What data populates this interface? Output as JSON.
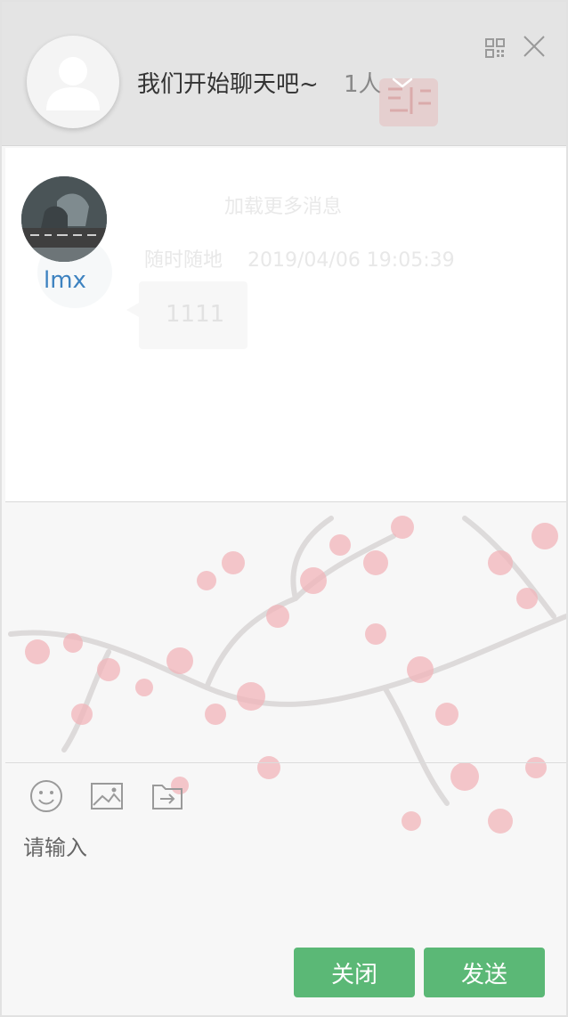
{
  "header": {
    "group_name": "我们开始聊天吧~",
    "member_count": "1人"
  },
  "messages": {
    "load_more": "加载更多消息",
    "items": [
      {
        "sender": "lmx",
        "source": "随时随地",
        "timestamp": "2019/04/06 19:05:39",
        "text": "1111"
      }
    ]
  },
  "composer": {
    "placeholder": "请输入",
    "close_label": "关闭",
    "send_label": "发送"
  },
  "icons": {
    "group_avatar": "user-silhouette-icon",
    "dropdown": "chevron-down-icon",
    "qr": "qr-code-icon",
    "close": "close-icon",
    "emoji": "smiley-icon",
    "image": "image-icon",
    "file": "file-send-icon"
  },
  "colors": {
    "accent_button": "#5bb876",
    "sender_name": "#3d82c0",
    "header_bg": "#e4e4e4"
  }
}
